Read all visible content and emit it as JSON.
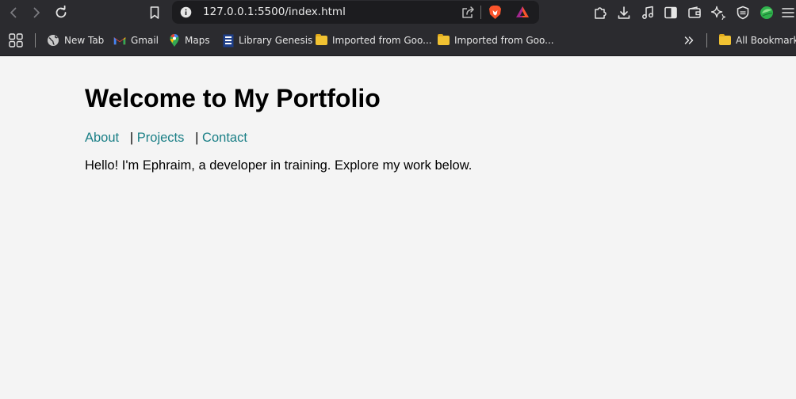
{
  "browser": {
    "url": "127.0.0.1:5500/index.html",
    "icons": {
      "back": "chevron-left-icon",
      "forward": "chevron-right-icon",
      "reload": "reload-icon",
      "bookmark": "bookmark-icon",
      "site_info": "info-icon",
      "share": "share-icon",
      "brave_shields": "brave-lion-icon",
      "brave_rewards": "brave-rewards-icon",
      "extensions": "puzzle-icon",
      "downloads": "download-icon",
      "media": "music-note-icon",
      "sidebar": "sidebar-icon",
      "wallet": "wallet-icon",
      "leo_ai": "sparkle-icon",
      "vpn": "shield-icon",
      "profile": "profile-avatar-icon",
      "menu": "hamburger-menu-icon"
    },
    "colors": {
      "toolbar_bg": "#2b2b2f",
      "omnibox_bg": "#1c1c1f",
      "brave_orange": "#fb542b"
    }
  },
  "bookmarks_bar": {
    "items": [
      {
        "label": "New Tab",
        "icon": "globe-icon"
      },
      {
        "label": "Gmail",
        "icon": "gmail-icon"
      },
      {
        "label": "Maps",
        "icon": "maps-pin-icon"
      },
      {
        "label": "Library Genesis",
        "icon": "library-genesis-icon"
      },
      {
        "label": "Imported from Goo...",
        "icon": "folder-icon"
      },
      {
        "label": "Imported from Goo...",
        "icon": "folder-icon"
      }
    ],
    "overflow_icon": "double-chevron-right-icon",
    "all_bookmarks": {
      "label": "All Bookmarks",
      "icon": "folder-icon"
    },
    "apps_icon": "apps-grid-icon"
  },
  "page": {
    "heading": "Welcome to My Portfolio",
    "nav": {
      "links": [
        "About",
        "Projects",
        "Contact"
      ],
      "separator": "|"
    },
    "intro": "Hello! I'm Ephraim, a developer in training. Explore my work below.",
    "colors": {
      "background": "#f4f4f4",
      "link": "#1a7f86",
      "text": "#000000"
    }
  }
}
